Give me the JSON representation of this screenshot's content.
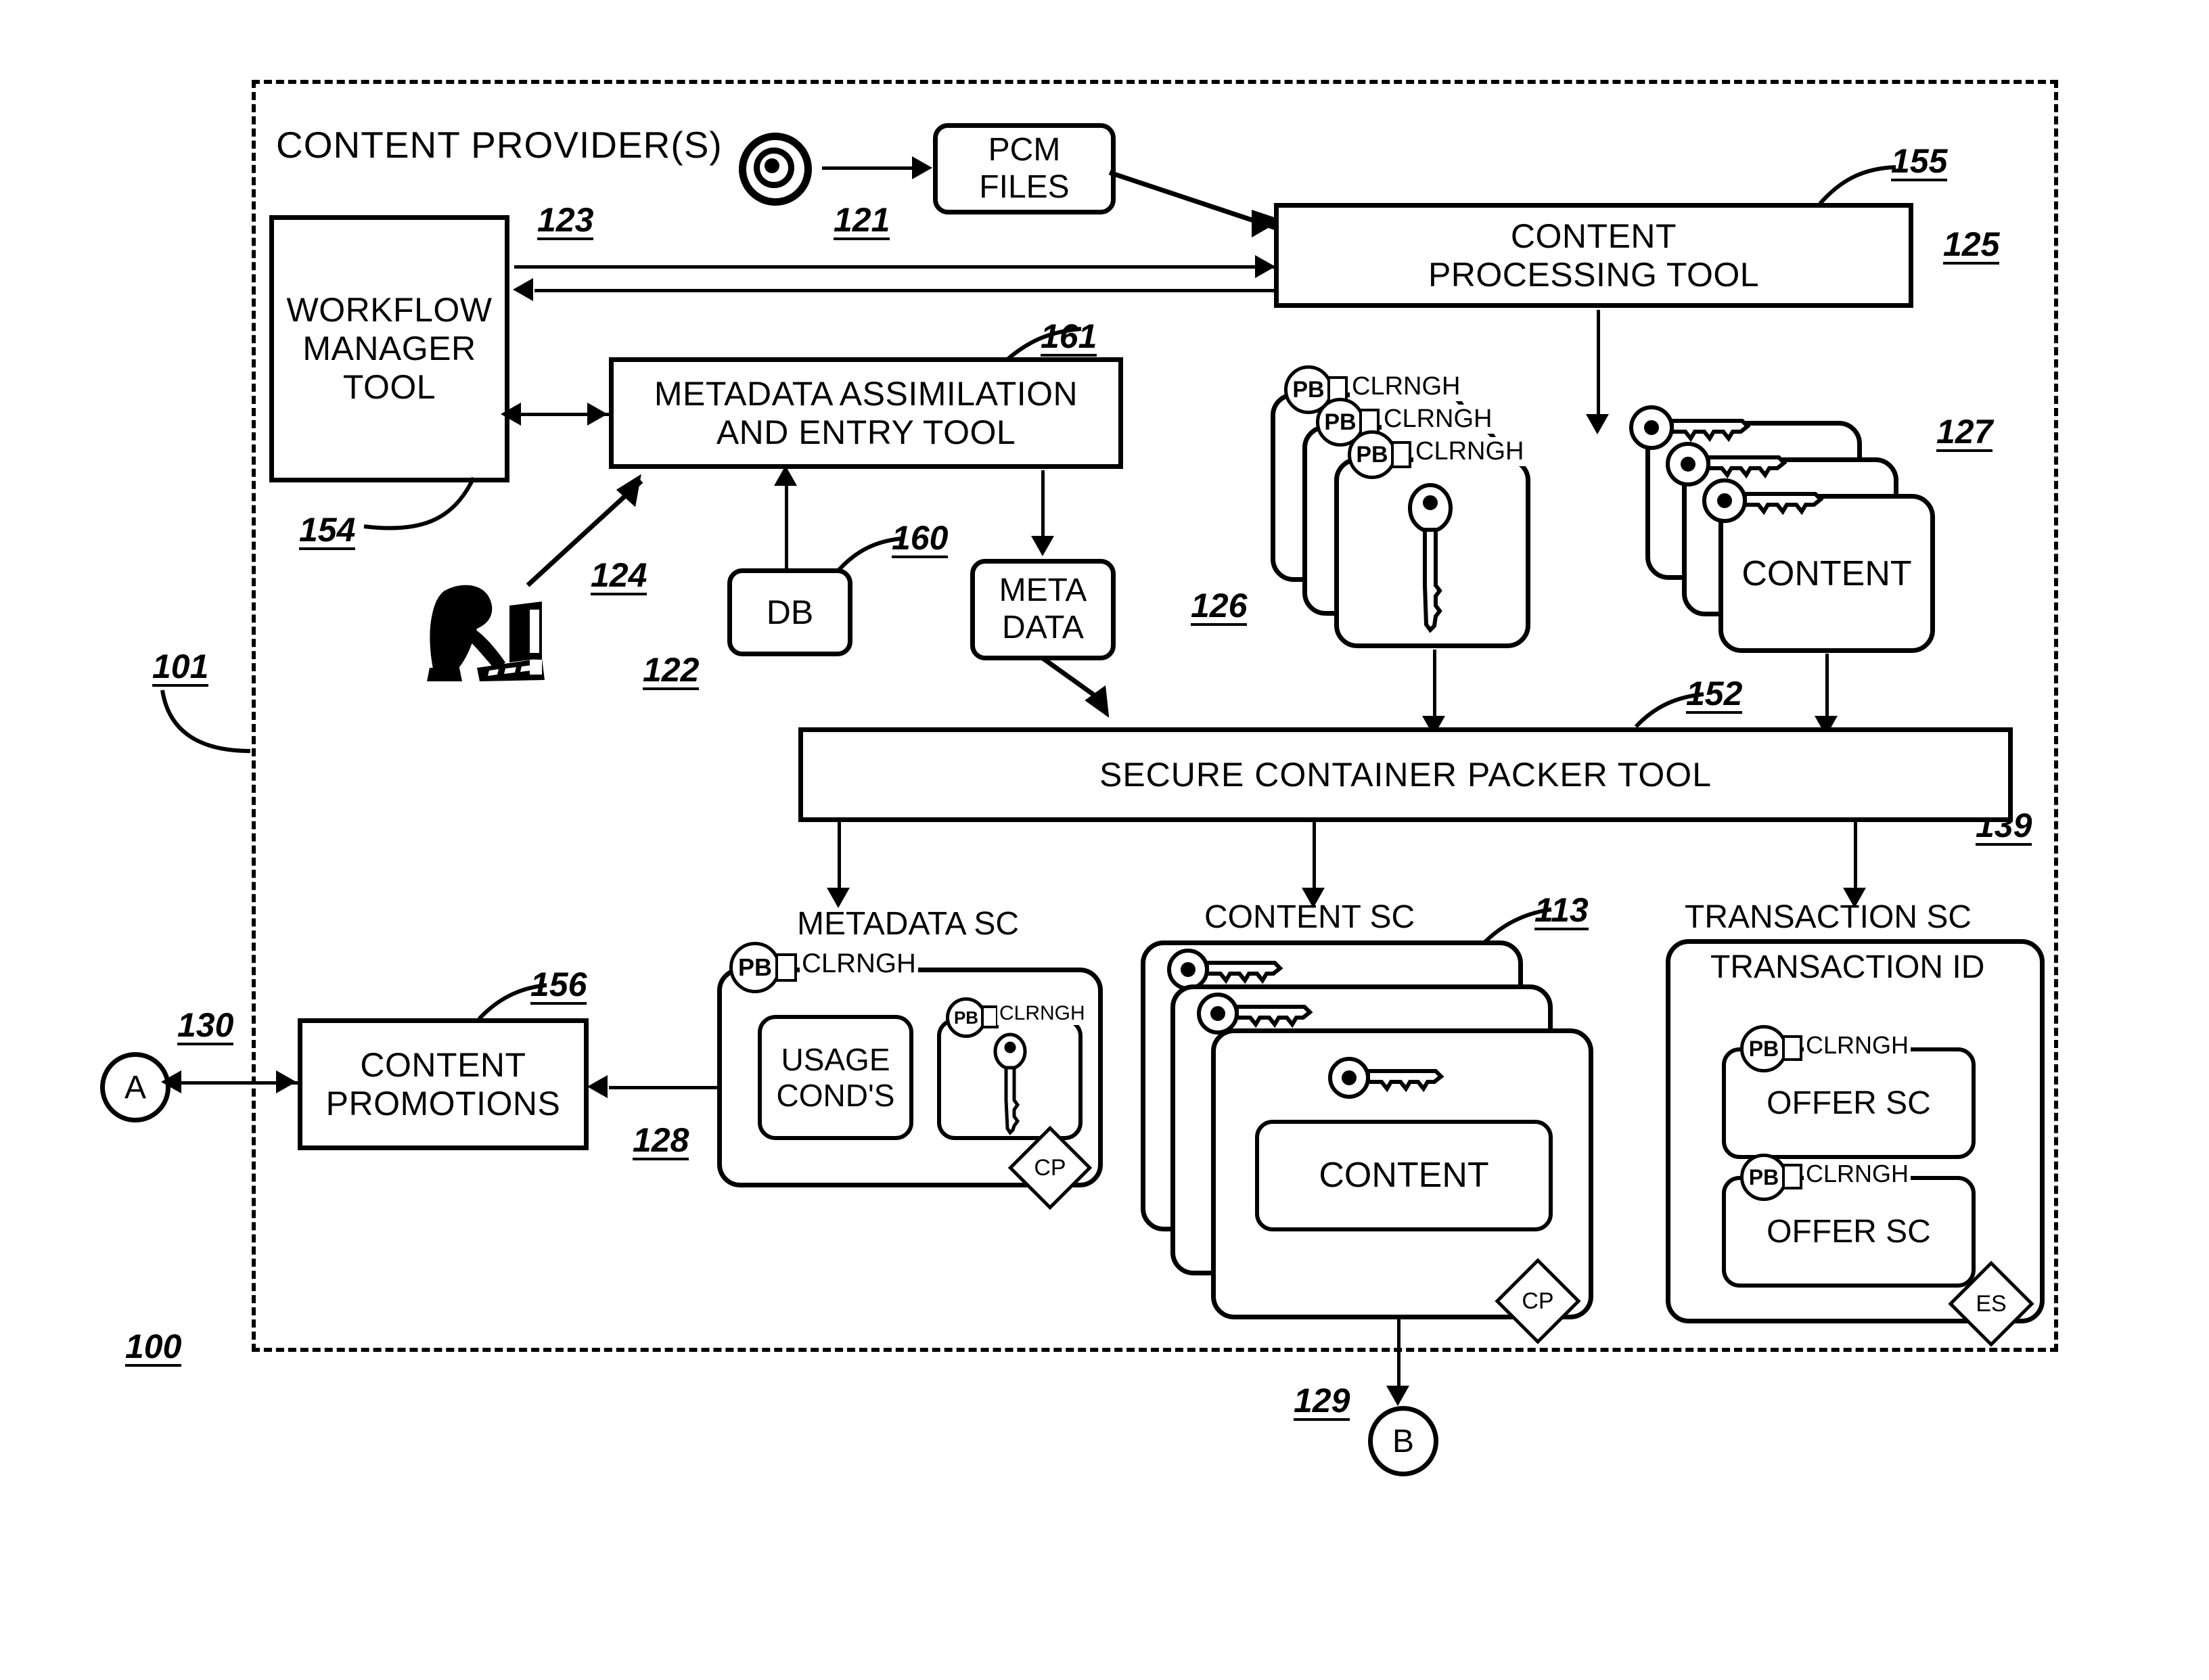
{
  "figure": {
    "outer_ref": "100",
    "boundary_ref": "101",
    "boundary_title": "CONTENT PROVIDER(S)",
    "right_edge_ref": "139"
  },
  "boxes": {
    "workflow": {
      "line1": "WORKFLOW",
      "line2": "MANAGER",
      "line3": "TOOL",
      "ref_top": "123",
      "ref_bottom": "154"
    },
    "metadata_tool": {
      "line1": "METADATA ASSIMILATION",
      "line2": "AND ENTRY TOOL",
      "ref": "161"
    },
    "content_processing": {
      "line1": "CONTENT",
      "line2": "PROCESSING TOOL",
      "ref_top": "155",
      "ref_right": "125"
    },
    "packer": {
      "label": "SECURE CONTAINER PACKER TOOL",
      "ref": "152"
    },
    "pcm_files": {
      "line1": "PCM",
      "line2": "FILES"
    },
    "db": {
      "label": "DB",
      "ref": "160"
    },
    "meta_data": {
      "line1": "META",
      "line2": "DATA"
    },
    "content_promotions": {
      "line1": "CONTENT",
      "line2": "PROMOTIONS",
      "ref": "156"
    }
  },
  "icons": {
    "bullseye_ref": "121",
    "operator_ref_left": "124",
    "operator_ref_right": "122"
  },
  "stacks": {
    "keys_stack": {
      "ref": "126",
      "badge": "PB",
      "clearinghouse": "CLRNGH",
      "count": 3
    },
    "content_stack": {
      "ref": "127",
      "label": "CONTENT",
      "count": 3
    }
  },
  "containers": {
    "metadata_sc": {
      "title": "METADATA SC",
      "ref": "128",
      "badge": "PB",
      "clearinghouse": "CLRNGH",
      "usage_line1": "USAGE",
      "usage_line2": "COND'S",
      "inner_badge": "PB",
      "inner_clearinghouse": "CLRNGH",
      "seal": "CP"
    },
    "content_sc": {
      "title": "CONTENT SC",
      "ref": "113",
      "label": "CONTENT",
      "seal": "CP",
      "count": 3
    },
    "transaction_sc": {
      "title": "TRANSACTION SC",
      "transaction_id": "TRANSACTION ID",
      "badge": "PB",
      "clearinghouse": "CLRNGH",
      "offer1": "OFFER SC",
      "offer2": "OFFER SC",
      "seal": "ES"
    }
  },
  "connectors": {
    "a_tag": "A",
    "a_ref": "130",
    "b_tag": "B",
    "b_ref": "129"
  },
  "colors": {
    "ink": "#000000",
    "paper": "#ffffff"
  }
}
